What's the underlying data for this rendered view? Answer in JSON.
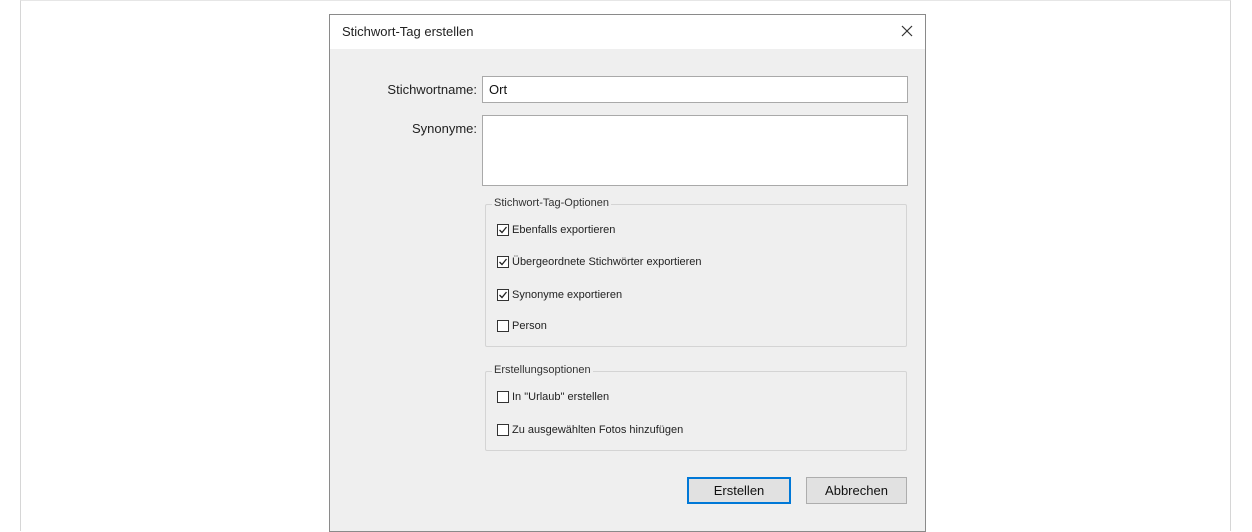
{
  "dialog": {
    "title": "Stichwort-Tag erstellen",
    "close_icon": "close-icon"
  },
  "form": {
    "name_label": "Stichwortname:",
    "name_value": "Ort",
    "synonyms_label": "Synonyme:",
    "synonyms_value": ""
  },
  "tag_options": {
    "legend": "Stichwort-Tag-Optionen",
    "items": [
      {
        "label": "Ebenfalls exportieren",
        "checked": true
      },
      {
        "label": "Übergeordnete Stichwörter exportieren",
        "checked": true
      },
      {
        "label": "Synonyme exportieren",
        "checked": true
      },
      {
        "label": "Person",
        "checked": false
      }
    ]
  },
  "create_options": {
    "legend": "Erstellungsoptionen",
    "items": [
      {
        "label": "In \"Urlaub\" erstellen",
        "checked": false
      },
      {
        "label": "Zu ausgewählten Fotos hinzufügen",
        "checked": false
      }
    ]
  },
  "buttons": {
    "create": "Erstellen",
    "cancel": "Abbrechen"
  },
  "colors": {
    "accent": "#0078d7",
    "dialog_bg": "#efefef"
  }
}
